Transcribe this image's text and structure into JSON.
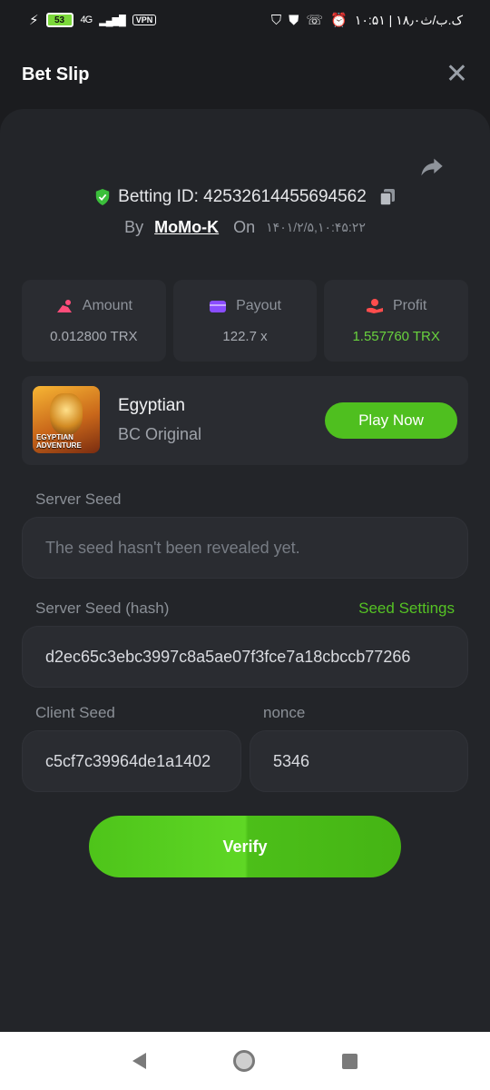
{
  "statusbar": {
    "battery": "53",
    "network": "4G",
    "vpn": "VPN",
    "time": "۱۰:۵۱ | ۱۸٫۰ک.ب/ث"
  },
  "header": {
    "title": "Bet Slip",
    "close_icon": "close-icon"
  },
  "bet": {
    "betting_id": "Betting ID: 425326144556945​62",
    "by_label": "By",
    "user": "MoMo-K",
    "on_label": "On",
    "date": "۱۴۰۱/۲/۵,۱۰:۴۵:۲۲"
  },
  "stats": [
    {
      "label": "Amount",
      "value": "0.012800 TRX",
      "icon": "money-bag-icon",
      "color": "#ff4d7a"
    },
    {
      "label": "Payout",
      "value": "122.7 x",
      "icon": "wallet-icon",
      "color": "#8a4dff"
    },
    {
      "label": "Profit",
      "value": "1.557760 TRX",
      "icon": "hand-coin-icon",
      "color": "#ff4d4d"
    }
  ],
  "game": {
    "thumb_text": "EGYPTIAN ADVENTURE",
    "name": "Egyptian",
    "provider": "BC Original",
    "play_label": "Play Now"
  },
  "seeds": {
    "server_seed_label": "Server Seed",
    "server_seed_value": "The seed hasn't been revealed yet.",
    "server_hash_label": "Server Seed (hash)",
    "seed_settings_label": "Seed Settings",
    "server_hash_value": "d2ec65c3ebc3997c8a5ae07f3fce7a18cbccb77266",
    "client_seed_label": "Client Seed",
    "client_seed_value": "c5cf7c39964de1a1402",
    "nonce_label": "nonce",
    "nonce_value": "5346"
  },
  "verify_label": "Verify",
  "colors": {
    "accent_green": "#4fbf1f",
    "background": "#1b1c1f",
    "card": "#232529"
  }
}
